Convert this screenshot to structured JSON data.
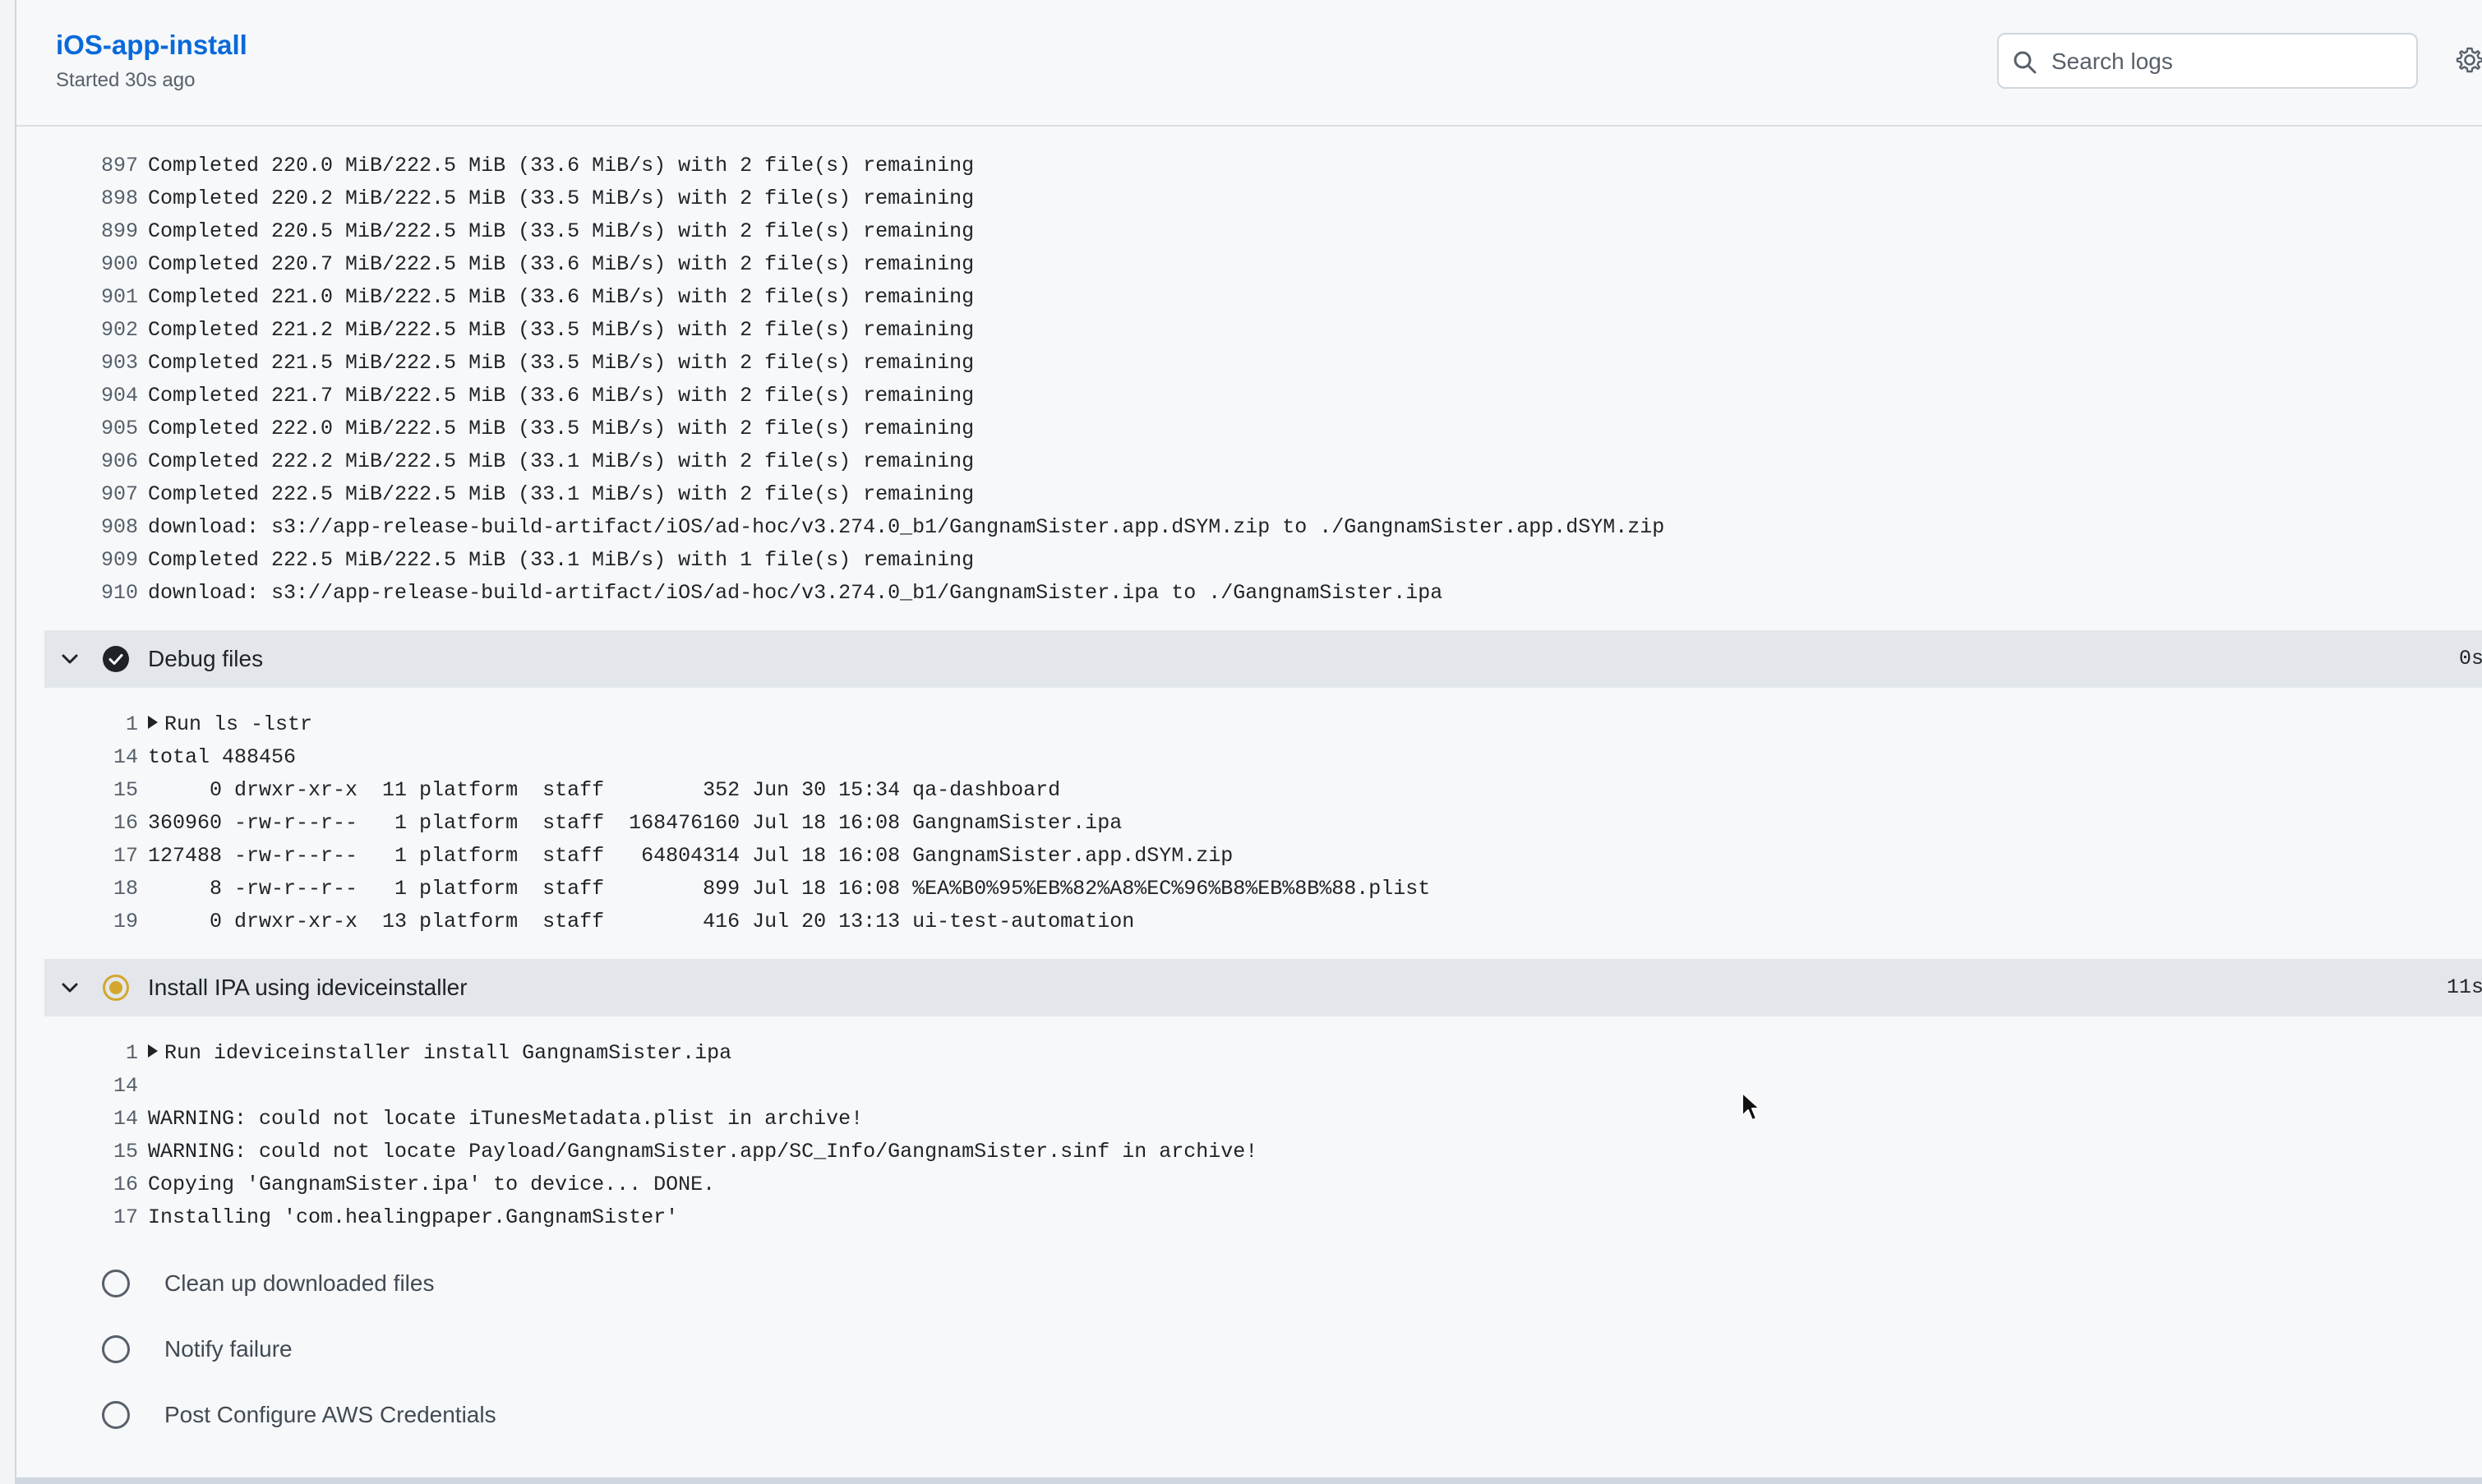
{
  "header": {
    "job_title": "iOS-app-install",
    "started": "Started 30s ago",
    "search_placeholder": "Search logs"
  },
  "top_log": [
    {
      "n": "897",
      "t": "Completed 220.0 MiB/222.5 MiB (33.6 MiB/s) with 2 file(s) remaining"
    },
    {
      "n": "898",
      "t": "Completed 220.2 MiB/222.5 MiB (33.5 MiB/s) with 2 file(s) remaining"
    },
    {
      "n": "899",
      "t": "Completed 220.5 MiB/222.5 MiB (33.5 MiB/s) with 2 file(s) remaining"
    },
    {
      "n": "900",
      "t": "Completed 220.7 MiB/222.5 MiB (33.6 MiB/s) with 2 file(s) remaining"
    },
    {
      "n": "901",
      "t": "Completed 221.0 MiB/222.5 MiB (33.6 MiB/s) with 2 file(s) remaining"
    },
    {
      "n": "902",
      "t": "Completed 221.2 MiB/222.5 MiB (33.5 MiB/s) with 2 file(s) remaining"
    },
    {
      "n": "903",
      "t": "Completed 221.5 MiB/222.5 MiB (33.5 MiB/s) with 2 file(s) remaining"
    },
    {
      "n": "904",
      "t": "Completed 221.7 MiB/222.5 MiB (33.6 MiB/s) with 2 file(s) remaining"
    },
    {
      "n": "905",
      "t": "Completed 222.0 MiB/222.5 MiB (33.5 MiB/s) with 2 file(s) remaining"
    },
    {
      "n": "906",
      "t": "Completed 222.2 MiB/222.5 MiB (33.1 MiB/s) with 2 file(s) remaining"
    },
    {
      "n": "907",
      "t": "Completed 222.5 MiB/222.5 MiB (33.1 MiB/s) with 2 file(s) remaining"
    },
    {
      "n": "908",
      "t": "download: s3://app-release-build-artifact/iOS/ad-hoc/v3.274.0_b1/GangnamSister.app.dSYM.zip to ./GangnamSister.app.dSYM.zip"
    },
    {
      "n": "909",
      "t": "Completed 222.5 MiB/222.5 MiB (33.1 MiB/s) with 1 file(s) remaining"
    },
    {
      "n": "910",
      "t": "download: s3://app-release-build-artifact/iOS/ad-hoc/v3.274.0_b1/GangnamSister.ipa to ./GangnamSister.ipa"
    }
  ],
  "debug_step": {
    "name": "Debug files",
    "duration": "0s",
    "status": "success",
    "run_line": {
      "n": "1",
      "t": "Run ls -lstr"
    },
    "lines": [
      {
        "n": "14",
        "t": "total 488456"
      },
      {
        "n": "15",
        "t": "     0 drwxr-xr-x  11 platform  staff        352 Jun 30 15:34 qa-dashboard"
      },
      {
        "n": "16",
        "t": "360960 -rw-r--r--   1 platform  staff  168476160 Jul 18 16:08 GangnamSister.ipa"
      },
      {
        "n": "17",
        "t": "127488 -rw-r--r--   1 platform  staff   64804314 Jul 18 16:08 GangnamSister.app.dSYM.zip"
      },
      {
        "n": "18",
        "t": "     8 -rw-r--r--   1 platform  staff        899 Jul 18 16:08 %EA%B0%95%EB%82%A8%EC%96%B8%EB%8B%88.plist"
      },
      {
        "n": "19",
        "t": "     0 drwxr-xr-x  13 platform  staff        416 Jul 20 13:13 ui-test-automation"
      }
    ]
  },
  "install_step": {
    "name": "Install IPA using ideviceinstaller",
    "duration": "11s",
    "status": "in-progress",
    "run_line": {
      "n": "1",
      "t": "Run ideviceinstaller install GangnamSister.ipa"
    },
    "lines": [
      {
        "n": "14",
        "t": ""
      },
      {
        "n": "14",
        "t": "WARNING: could not locate iTunesMetadata.plist in archive!"
      },
      {
        "n": "15",
        "t": "WARNING: could not locate Payload/GangnamSister.app/SC_Info/GangnamSister.sinf in archive!"
      },
      {
        "n": "16",
        "t": "Copying 'GangnamSister.ipa' to device... DONE."
      },
      {
        "n": "17",
        "t": "Installing 'com.healingpaper.GangnamSister'"
      }
    ]
  },
  "pending_steps": [
    {
      "name": "Clean up downloaded files"
    },
    {
      "name": "Notify failure"
    },
    {
      "name": "Post Configure AWS Credentials"
    }
  ],
  "colors": {
    "accent": "#0969da",
    "success": "#1f2328",
    "in_progress": "#d4a72c",
    "step_header_bg": "#e3e7eb"
  }
}
